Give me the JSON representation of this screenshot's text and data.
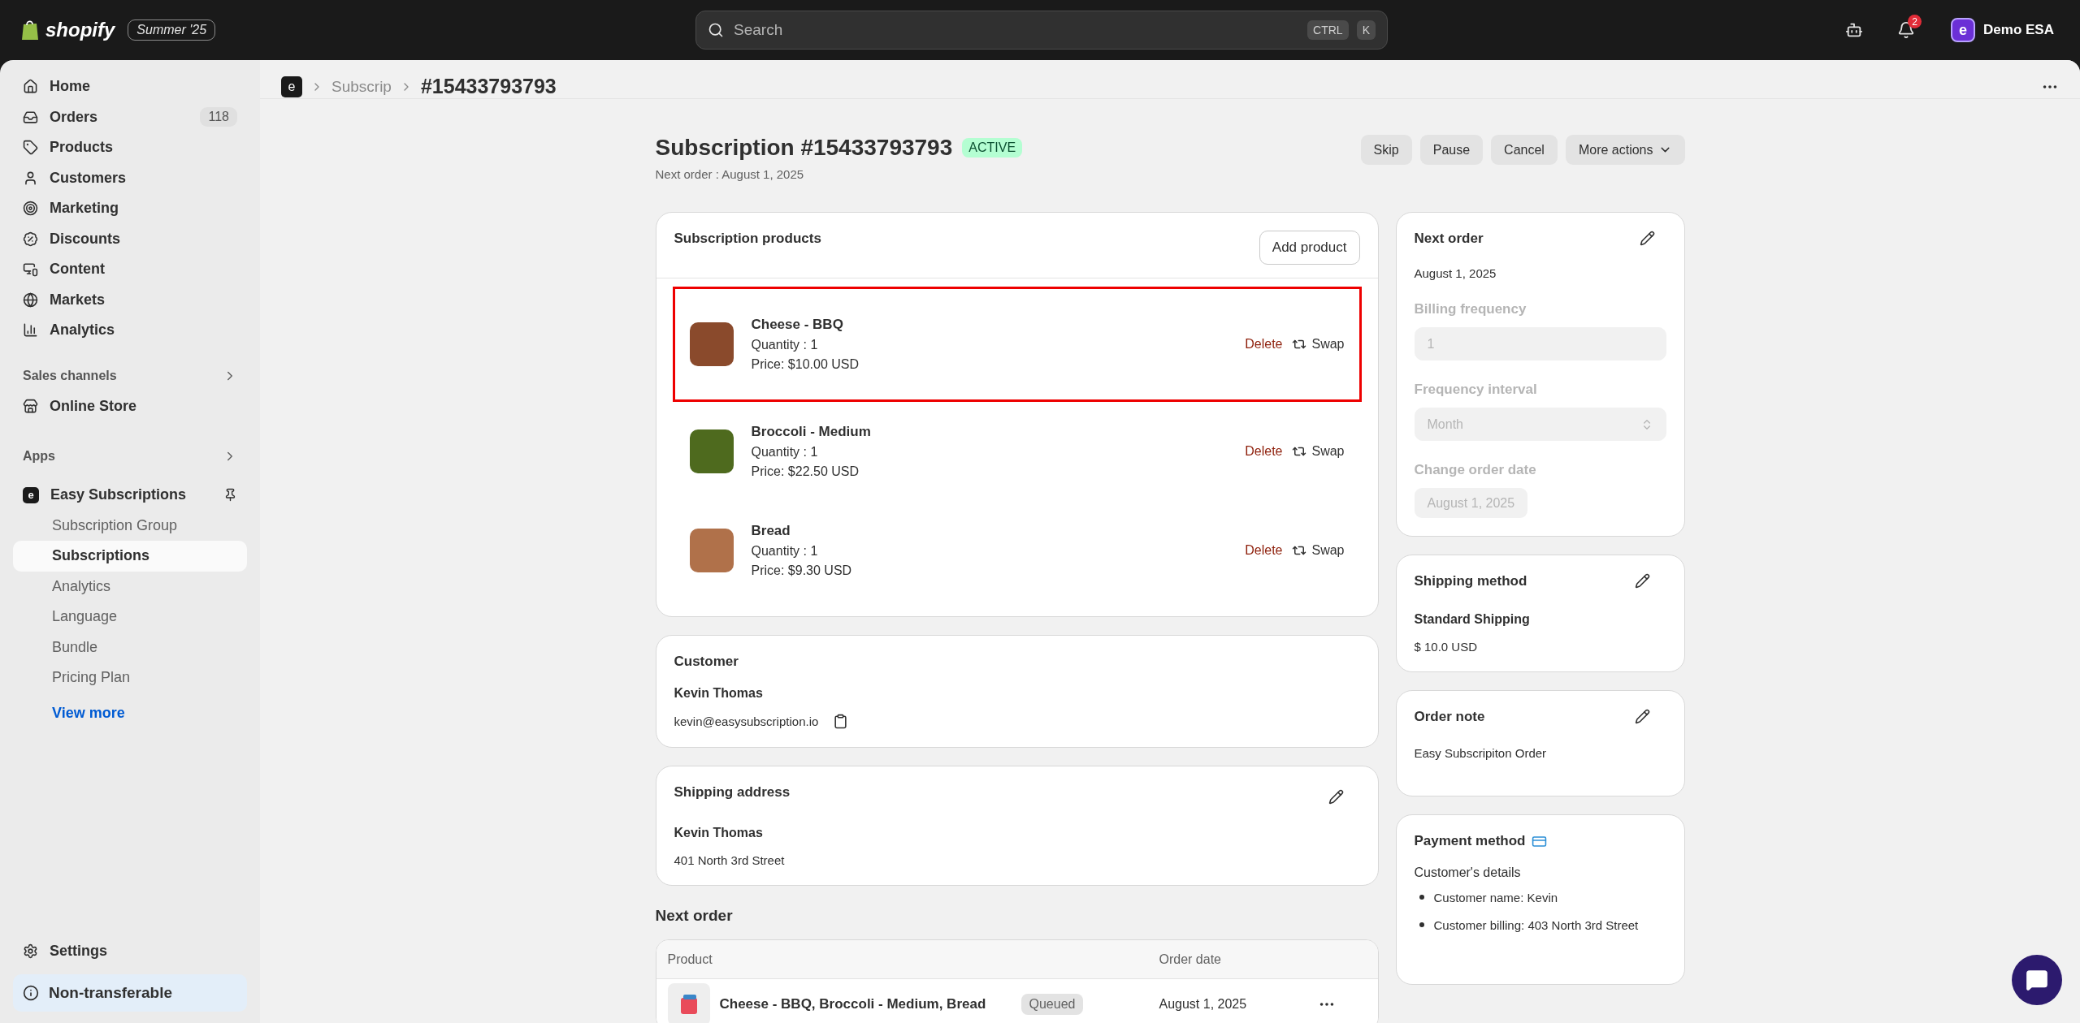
{
  "topbar": {
    "brand": "shopify",
    "edition": "Summer '25",
    "search": {
      "placeholder": "Search",
      "keys": [
        "CTRL",
        "K"
      ]
    },
    "notifications": {
      "count": "2"
    },
    "store": {
      "initial": "e",
      "name": "Demo ESA"
    }
  },
  "sidebar": {
    "nav": [
      {
        "label": "Home"
      },
      {
        "label": "Orders",
        "count": "118"
      },
      {
        "label": "Products"
      },
      {
        "label": "Customers"
      },
      {
        "label": "Marketing"
      },
      {
        "label": "Discounts"
      },
      {
        "label": "Content"
      },
      {
        "label": "Markets"
      },
      {
        "label": "Analytics"
      }
    ],
    "sales_channels": {
      "heading": "Sales channels",
      "items": [
        {
          "label": "Online Store"
        }
      ]
    },
    "apps": {
      "heading": "Apps",
      "app": {
        "label": "Easy Subscriptions",
        "initial": "e",
        "children": [
          {
            "label": "Subscription Group",
            "selected": false
          },
          {
            "label": "Subscriptions",
            "selected": true
          },
          {
            "label": "Analytics",
            "selected": false
          },
          {
            "label": "Language",
            "selected": false
          },
          {
            "label": "Bundle",
            "selected": false
          },
          {
            "label": "Pricing Plan",
            "selected": false
          }
        ]
      },
      "view_more": "View more"
    },
    "settings": "Settings",
    "notice": "Non-transferable"
  },
  "breadcrumb": {
    "app_initial": "e",
    "items": [
      "Subscrip",
      "#15433793793"
    ]
  },
  "header": {
    "title": "Subscription #15433793793",
    "status": "ACTIVE",
    "subtitle": "Next order : August 1, 2025",
    "actions": [
      {
        "label": "Skip",
        "kind": "plain"
      },
      {
        "label": "Pause",
        "kind": "plain"
      },
      {
        "label": "Cancel",
        "kind": "plain"
      },
      {
        "label": "More actions",
        "kind": "menu"
      }
    ]
  },
  "products_card": {
    "title": "Subscription products",
    "add_button": "Add product",
    "items": [
      {
        "name": "Cheese - BBQ",
        "quantity": "Quantity : 1",
        "price": "Price: $10.00 USD",
        "color": "#8a4a2c",
        "highlighted": true,
        "delete": "Delete",
        "swap": "Swap"
      },
      {
        "name": "Broccoli - Medium",
        "quantity": "Quantity : 1",
        "price": "Price: $22.50 USD",
        "color": "#4e6a1e",
        "highlighted": false,
        "delete": "Delete",
        "swap": "Swap"
      },
      {
        "name": "Bread",
        "quantity": "Quantity : 1",
        "price": "Price: $9.30 USD",
        "color": "#b0714a",
        "highlighted": false,
        "delete": "Delete",
        "swap": "Swap"
      }
    ]
  },
  "customer_card": {
    "title": "Customer",
    "name": "Kevin Thomas",
    "email": "kevin@easysubscription.io"
  },
  "shipping_address_card": {
    "title": "Shipping address",
    "name": "Kevin Thomas",
    "address": "401 North 3rd Street"
  },
  "next_order_section": {
    "heading": "Next order",
    "columns": [
      "Product",
      "Order date"
    ],
    "rows": [
      {
        "products": "Cheese - BBQ,  Broccoli - Medium,  Bread",
        "status": "Queued",
        "date": "August 1, 2025"
      }
    ]
  },
  "next_order_card": {
    "title": "Next order",
    "date": "August 1, 2025",
    "fields": [
      {
        "label": "Billing frequency",
        "value": "1",
        "kind": "input",
        "disabled": true
      },
      {
        "label": "Frequency interval",
        "value": "Month",
        "kind": "select",
        "disabled": true
      },
      {
        "label": "Change order date",
        "value": "August 1, 2025",
        "kind": "button",
        "disabled": true
      }
    ]
  },
  "shipping_method_card": {
    "title": "Shipping method",
    "method": "Standard Shipping",
    "price": "$ 10.0 USD"
  },
  "order_note_card": {
    "title": "Order note",
    "note": "Easy Subscripiton Order"
  },
  "payment_card": {
    "title": "Payment method",
    "subtitle": "Customer's details",
    "details": [
      "Customer name: Kevin",
      "Customer billing: 403 North 3rd Street"
    ]
  }
}
